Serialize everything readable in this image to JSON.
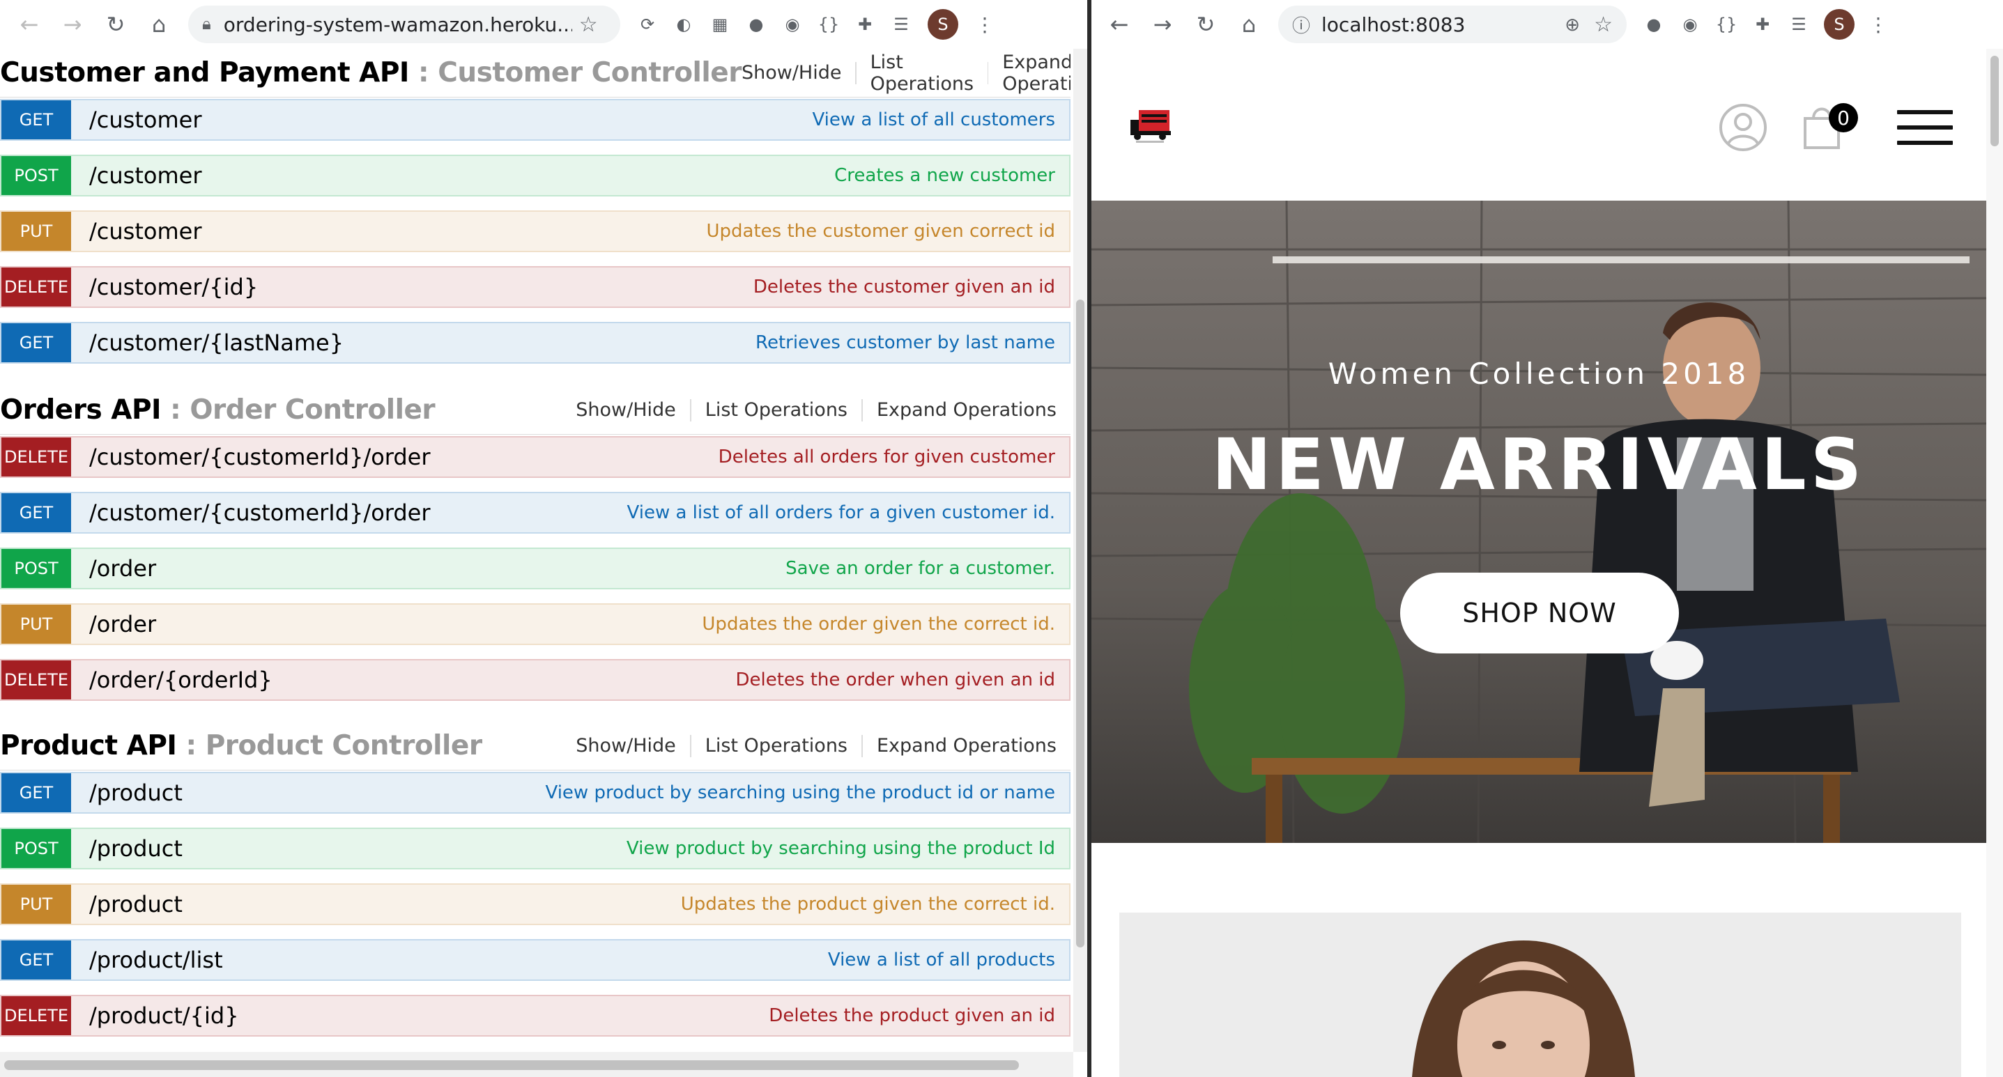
{
  "left_browser": {
    "url": "ordering-system-wamazon.heroku..."
  },
  "right_browser": {
    "url": "localhost:8083"
  },
  "profile_initial": "S",
  "api_links": {
    "show_hide": "Show/Hide",
    "list_operations": "List Operations",
    "expand_operations": "Expand Operations"
  },
  "sections": [
    {
      "title": "Customer and Payment API",
      "separator": " : ",
      "controller": "Customer Controller",
      "operations": [
        {
          "method": "GET",
          "path": "/customer",
          "description": "View a list of all customers"
        },
        {
          "method": "POST",
          "path": "/customer",
          "description": "Creates a new customer"
        },
        {
          "method": "PUT",
          "path": "/customer",
          "description": "Updates the customer given correct id"
        },
        {
          "method": "DELETE",
          "path": "/customer/{id}",
          "description": "Deletes the customer given an id"
        },
        {
          "method": "GET",
          "path": "/customer/{lastName}",
          "description": "Retrieves customer by last name"
        }
      ]
    },
    {
      "title": "Orders API",
      "separator": " : ",
      "controller": "Order Controller",
      "operations": [
        {
          "method": "DELETE",
          "path": "/customer/{customerId}/order",
          "description": "Deletes all orders for given customer"
        },
        {
          "method": "GET",
          "path": "/customer/{customerId}/order",
          "description": "View a list of all orders for a given customer id."
        },
        {
          "method": "POST",
          "path": "/order",
          "description": "Save an order for a customer."
        },
        {
          "method": "PUT",
          "path": "/order",
          "description": "Updates the order given the correct id."
        },
        {
          "method": "DELETE",
          "path": "/order/{orderId}",
          "description": "Deletes the order when given an id"
        }
      ]
    },
    {
      "title": "Product API",
      "separator": " : ",
      "controller": "Product Controller",
      "operations": [
        {
          "method": "GET",
          "path": "/product",
          "description": "View product by searching using the product id or name"
        },
        {
          "method": "POST",
          "path": "/product",
          "description": "View product by searching using the product Id"
        },
        {
          "method": "PUT",
          "path": "/product",
          "description": "Updates the product given the correct id."
        },
        {
          "method": "GET",
          "path": "/product/list",
          "description": "View a list of all products"
        },
        {
          "method": "DELETE",
          "path": "/product/{id}",
          "description": "Deletes the product given an id"
        }
      ]
    }
  ],
  "store": {
    "cart_count": "0",
    "hero_subtitle": "Women Collection 2018",
    "hero_title": "NEW ARRIVALS",
    "cta": "SHOP NOW"
  },
  "icons": [
    "back-icon",
    "forward-icon",
    "reload-icon",
    "home-icon",
    "lock-icon",
    "info-icon",
    "zoom-icon",
    "star-icon",
    "extension-icon",
    "reading-list-icon",
    "menu-dots-icon",
    "user-icon",
    "cart-icon",
    "hamburger-menu-icon"
  ],
  "colors": {
    "get": "#0f6ab4",
    "post": "#10a54a",
    "put": "#c5862b",
    "delete": "#a41e22",
    "controller_gray": "#999999"
  }
}
